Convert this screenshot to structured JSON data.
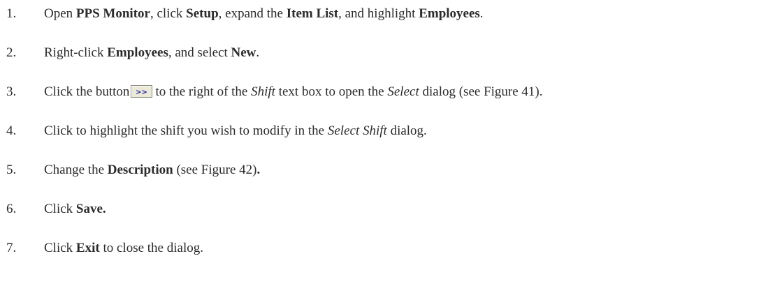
{
  "steps": [
    {
      "number": "1.",
      "parts": [
        {
          "t": "Open "
        },
        {
          "t": "PPS Monitor",
          "s": "b"
        },
        {
          "t": ", click "
        },
        {
          "t": "Setup",
          "s": "b"
        },
        {
          "t": ", expand the "
        },
        {
          "t": "Item List",
          "s": "b"
        },
        {
          "t": ", and highlight "
        },
        {
          "t": "Employees",
          "s": "b"
        },
        {
          "t": "."
        }
      ]
    },
    {
      "number": "2.",
      "parts": [
        {
          "t": "Right-click "
        },
        {
          "t": "Employees",
          "s": "b"
        },
        {
          "t": ", and select "
        },
        {
          "t": "New",
          "s": "b"
        },
        {
          "t": "."
        }
      ]
    },
    {
      "number": "3.",
      "parts": [
        {
          "t": "Click the button"
        },
        {
          "icon": "browse-button-icon"
        },
        {
          "t": "to the right of the "
        },
        {
          "t": "Shift",
          "s": "i"
        },
        {
          "t": " text box to open the "
        },
        {
          "t": "Select",
          "s": "i"
        },
        {
          "t": " dialog (see Figure 41)."
        }
      ]
    },
    {
      "number": "4.",
      "parts": [
        {
          "t": "Click to highlight the shift you wish to modify in the "
        },
        {
          "t": "Select Shift",
          "s": "i"
        },
        {
          "t": " dialog."
        }
      ]
    },
    {
      "number": "5.",
      "parts": [
        {
          "t": "Change the "
        },
        {
          "t": "Description",
          "s": "b"
        },
        {
          "t": " (see Figure 42)"
        },
        {
          "t": ".",
          "s": "b"
        }
      ]
    },
    {
      "number": "6.",
      "parts": [
        {
          "t": "Click "
        },
        {
          "t": "Save.",
          "s": "b"
        }
      ]
    },
    {
      "number": "7.",
      "parts": [
        {
          "t": "Click "
        },
        {
          "t": "Exit",
          "s": "b"
        },
        {
          "t": " to close the dialog."
        }
      ]
    }
  ],
  "browse_button": {
    "label": ">>",
    "colors": {
      "face": "#ece9d8",
      "border": "#8a8a7a",
      "text": "#1a1aa0"
    }
  }
}
